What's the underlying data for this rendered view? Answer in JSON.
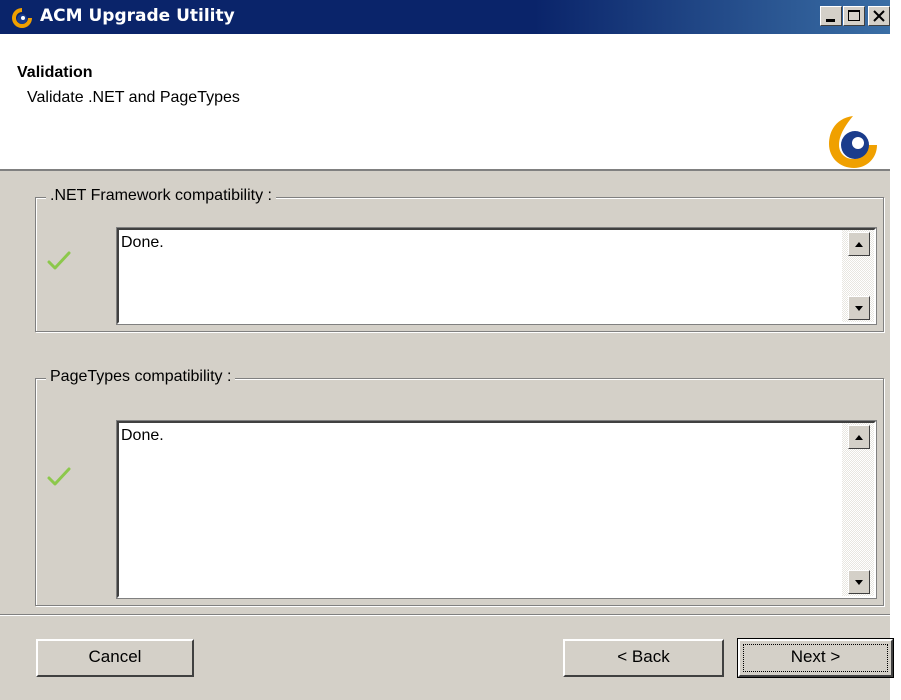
{
  "window": {
    "title": "ACM Upgrade Utility",
    "controls": [
      "minimize-icon",
      "maximize-icon",
      "close-icon"
    ]
  },
  "header": {
    "title": "Validation",
    "subtitle": "Validate .NET and PageTypes",
    "logo_icon": "app-logo-icon"
  },
  "groups": [
    {
      "label": ".NET Framework compatibility :",
      "status_icon": "checkmark-icon",
      "output": "Done."
    },
    {
      "label": "PageTypes compatibility :",
      "status_icon": "checkmark-icon",
      "output": "Done."
    }
  ],
  "buttons": {
    "cancel": "Cancel",
    "back": "< Back",
    "next": "Next >"
  },
  "colors": {
    "titlebar": "#0a246a",
    "face": "#d4d0c8",
    "check": "#8cc84b",
    "logo_orange": "#f0a000",
    "logo_blue": "#1a3c8c"
  }
}
